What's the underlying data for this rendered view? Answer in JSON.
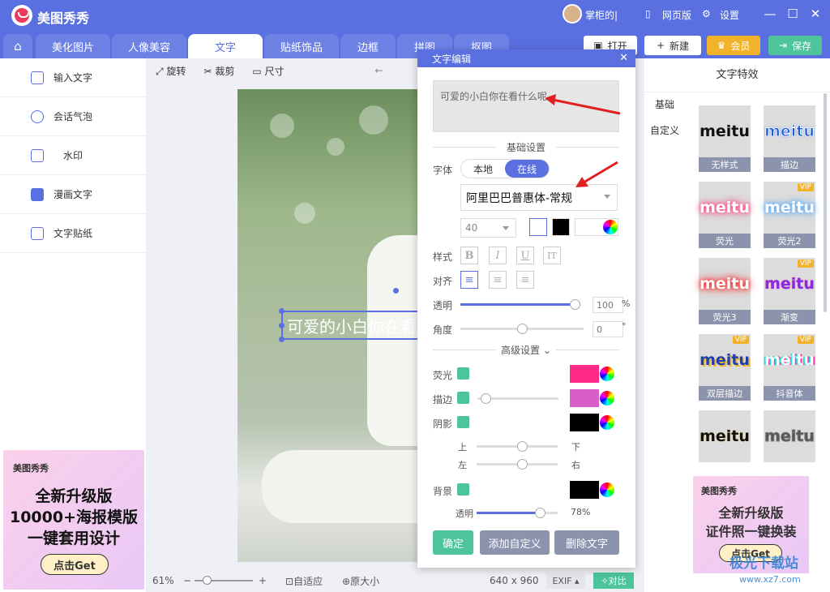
{
  "app": {
    "name": "美图秀秀",
    "user": "掌柜的|",
    "links": [
      "网页版",
      "设置"
    ]
  },
  "tabs": [
    "美化图片",
    "人像美容",
    "文字",
    "贴纸饰品",
    "边框",
    "拼图",
    "抠图"
  ],
  "active_tab": "文字",
  "header_buttons": {
    "open": "打开",
    "new": "新建",
    "vip": "会员",
    "save": "保存"
  },
  "sidebar": {
    "items": [
      "输入文字",
      "会话气泡",
      "水印",
      "漫画文字",
      "文字贴纸"
    ]
  },
  "ad_left": {
    "brand": "美图秀秀",
    "lines": [
      "全新升级版",
      "10000+海报模版",
      "一键套用设计"
    ],
    "cta": "点击Get"
  },
  "toolbar": {
    "rotate": "旋转",
    "crop": "裁剪",
    "size": "尺寸"
  },
  "canvas": {
    "text": "可爱的小白你在看什么呢"
  },
  "status": {
    "zoom": "61%",
    "fit": "自适应",
    "original": "原大小",
    "dimensions": "640 x 960",
    "exif": "EXIF",
    "compare": "对比"
  },
  "dialog": {
    "title": "文字编辑",
    "text_value": "可爱的小白你在看什么呢",
    "basic_section": "基础设置",
    "font_label": "字体",
    "font_tabs": [
      "本地",
      "在线"
    ],
    "font_active": "在线",
    "font_name": "阿里巴巴普惠体-常规",
    "font_size": "40",
    "style_label": "样式",
    "style_buttons": [
      "B",
      "I",
      "U",
      "IT"
    ],
    "align_label": "对齐",
    "opacity_label": "透明",
    "opacity_value": "100",
    "opacity_unit": "%",
    "opacity": 100,
    "angle_label": "角度",
    "angle_value": "0",
    "angle_unit": "°",
    "advanced_section": "高级设置",
    "glow_label": "荧光",
    "glow_color": "#ff2a86",
    "stroke_label": "描边",
    "stroke_color": "#d85fc8",
    "shadow_label": "阴影",
    "shadow_color": "#000000",
    "shadow_up": "上",
    "shadow_down": "下",
    "shadow_left": "左",
    "shadow_right": "右",
    "bg_label": "背景",
    "bg_color": "#000000",
    "bg_opacity_label": "透明",
    "bg_opacity_value": "78%",
    "bg_opacity": 78,
    "buttons": {
      "ok": "确定",
      "add_custom": "添加自定义",
      "delete": "删除文字"
    }
  },
  "right_panel": {
    "title": "文字特效",
    "tabs": [
      "基础",
      "自定义"
    ],
    "effects": [
      {
        "name": "无样式",
        "preview": "meitu",
        "vip": ""
      },
      {
        "name": "描边",
        "preview": "meitu",
        "vip": ""
      },
      {
        "name": "荧光",
        "preview": "meitu",
        "vip": ""
      },
      {
        "name": "荧光2",
        "preview": "meitu",
        "vip": "VIP"
      },
      {
        "name": "荧光3",
        "preview": "meitu",
        "vip": ""
      },
      {
        "name": "渐变",
        "preview": "meitu",
        "vip": "VIP"
      },
      {
        "name": "双层描边",
        "preview": "meitu",
        "vip": "VIP"
      },
      {
        "name": "抖音体",
        "preview": "meitu",
        "vip": "VIP"
      },
      {
        "name": "",
        "preview": "meitu",
        "vip": ""
      },
      {
        "name": "",
        "preview": "meitu",
        "vip": ""
      }
    ]
  },
  "ad_right": {
    "brand": "美图秀秀",
    "lines": [
      "全新升级版",
      "证件照一键换装"
    ],
    "cta": "点击Get"
  },
  "watermark": {
    "text": "极光下载站",
    "url": "www.xz7.com"
  },
  "colors": {
    "accent": "#5a70e0",
    "green": "#4dc49a",
    "vip": "#f2b32b"
  }
}
